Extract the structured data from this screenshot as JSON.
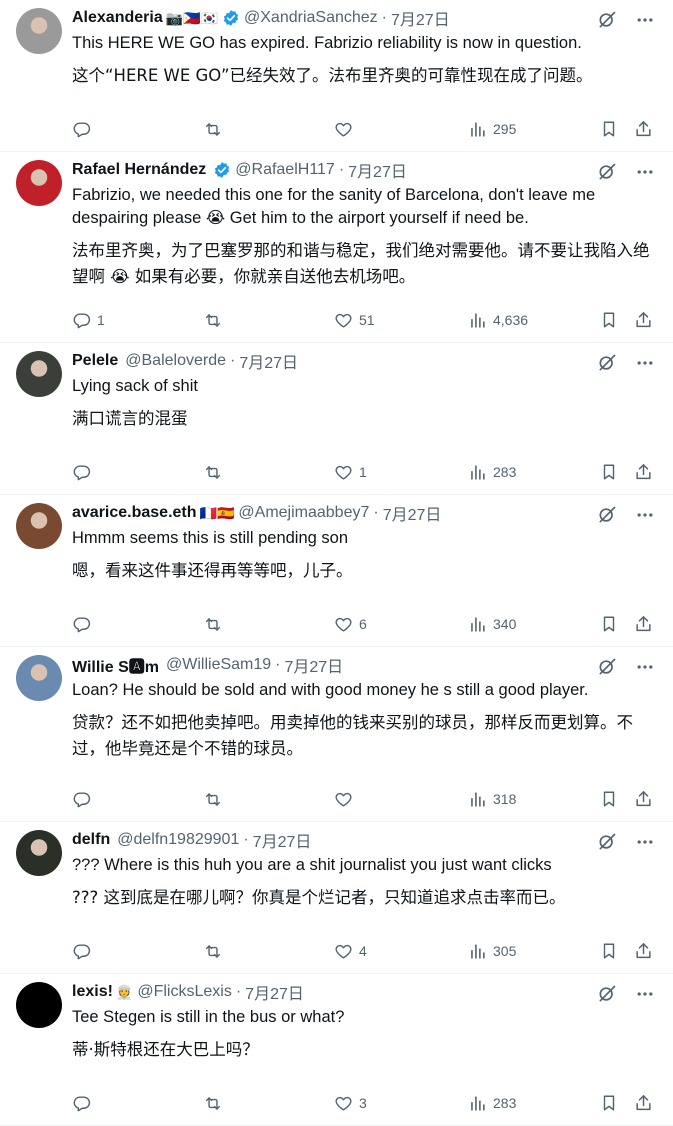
{
  "tweets": [
    {
      "name": "Alexanderia",
      "emoji": "📷🇵🇭🇰🇷",
      "verified": true,
      "handle": "@XandriaSanchez",
      "date": "7月27日",
      "text_en": "This HERE WE GO has expired. Fabrizio reliability is now in question.",
      "text_zh": "这个“HERE WE GO”已经失效了。法布里齐奥的可靠性现在成了问题。",
      "replies": "",
      "reposts": "",
      "likes": "",
      "views": "295",
      "avatar_color": "#9a9a9a"
    },
    {
      "name": "Rafael Hernández",
      "emoji": "",
      "verified": true,
      "handle": "@RafaelH117",
      "date": "7月27日",
      "text_en": "Fabrizio, we needed this one for the sanity of Barcelona, don't leave me despairing please 😭 Get him to the airport yourself if need be.",
      "text_zh": "法布里齐奥，为了巴塞罗那的和谐与稳定，我们绝对需要他。请不要让我陷入绝望啊 😭 如果有必要，你就亲自送他去机场吧。",
      "replies": "1",
      "reposts": "",
      "likes": "51",
      "views": "4,636",
      "avatar_color": "#c0202a"
    },
    {
      "name": "Pelele",
      "emoji": "",
      "verified": false,
      "handle": "@Baleloverde",
      "date": "7月27日",
      "text_en": "Lying sack of shit",
      "text_zh": "满口谎言的混蛋",
      "replies": "",
      "reposts": "",
      "likes": "1",
      "views": "283",
      "avatar_color": "#3a3f3a"
    },
    {
      "name": "avarice.base.eth",
      "emoji": "🇫🇷🇪🇸",
      "verified": false,
      "handle": "@Amejimaabbey7",
      "date": "7月27日",
      "text_en": "Hmmm seems this is still pending son",
      "text_zh": "嗯，看来这件事还得再等等吧，儿子。",
      "replies": "",
      "reposts": "",
      "likes": "6",
      "views": "340",
      "avatar_color": "#7a4a30"
    },
    {
      "name": "Willie S🅰m",
      "emoji": "",
      "verified": false,
      "handle": "@WillieSam19",
      "date": "7月27日",
      "text_en": "Loan? He should be sold and with good money he s still a good player.",
      "text_zh": "贷款？还不如把他卖掉吧。用卖掉他的钱来买别的球员，那样反而更划算。不过，他毕竟还是个不错的球员。",
      "replies": "",
      "reposts": "",
      "likes": "",
      "views": "318",
      "avatar_color": "#6a8ab0"
    },
    {
      "name": "delfn",
      "emoji": "",
      "verified": false,
      "handle": "@delfn19829901",
      "date": "7月27日",
      "text_en": "??? Where is this huh you are a shit journalist you just want clicks",
      "text_zh": "??? 这到底是在哪儿啊？你真是个烂记者，只知道追求点击率而已。",
      "replies": "",
      "reposts": "",
      "likes": "4",
      "views": "305",
      "avatar_color": "#2a3028"
    },
    {
      "name": "lexis!",
      "emoji": "👳",
      "verified": false,
      "handle": "@FlicksLexis",
      "date": "7月27日",
      "text_en": "Tee Stegen is still in the bus or what?",
      "text_zh": "蒂·斯特根还在大巴上吗？",
      "replies": "",
      "reposts": "",
      "likes": "3",
      "views": "283",
      "avatar_color": "#000000"
    }
  ],
  "icons": {
    "reply": "reply-icon",
    "repost": "repost-icon",
    "like": "like-icon",
    "views": "views-icon",
    "bookmark": "bookmark-icon",
    "share": "share-icon",
    "grok": "grok-icon",
    "more": "more-icon",
    "verified": "verified-badge-icon"
  },
  "colors": {
    "text": "#0f1419",
    "secondary": "#536471",
    "verified": "#1d9bf0",
    "divider": "#eff3f4"
  }
}
